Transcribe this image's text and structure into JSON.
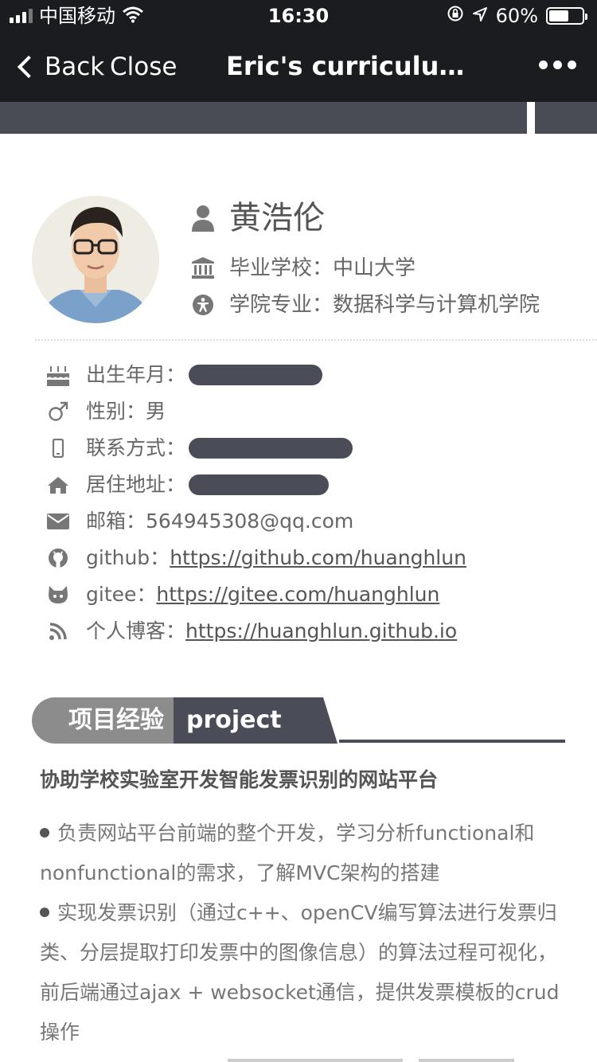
{
  "status_bar": {
    "carrier": "中国移动",
    "time": "16:30",
    "battery": "60%",
    "battery_level": 0.6
  },
  "nav": {
    "back_label": "Back",
    "close_label": "Close",
    "title": "Eric's curriculum..."
  },
  "profile": {
    "name": "黄浩伦",
    "school_label": "毕业学校：",
    "school": "中山大学",
    "major_label": "学院专业：",
    "major": "数据科学与计算机学院"
  },
  "details": {
    "birth_label": "出生年月：",
    "gender_label": "性别：",
    "gender": "男",
    "contact_label": "联系方式：",
    "address_label": "居住地址：",
    "email_label": "邮箱：",
    "email": "564945308@qq.com",
    "github_label": "github：",
    "github_url": "https://github.com/huanghlun",
    "gitee_label": "gitee：",
    "gitee_url": "https://gitee.com/huanghlun",
    "blog_label": "个人博客：",
    "blog_url": "https://huanghlun.github.io"
  },
  "section": {
    "title_cn": "项目经验",
    "title_en": "project"
  },
  "project": {
    "title": "协助学校实验室开发智能发票识别的网站平台",
    "bullets": [
      "负责网站平台前端的整个开发，学习分析functional和nonfunctional的需求，了解MVC架构的搭建",
      "实现发票识别（通过c++、openCV编写算法进行发票归类、分层提取打印发票中的图像信息）的算法过程可视化，前后端通过ajax + websocket通信，提供发票模板的crud操作"
    ]
  },
  "icons": {
    "status": [
      "signal-icon",
      "wifi-icon",
      "orientation-lock-icon",
      "location-icon",
      "battery-icon"
    ],
    "profile": [
      "user-icon",
      "university-icon",
      "universal-access-icon"
    ],
    "details": [
      "birthday-cake-icon",
      "male-icon",
      "mobile-icon",
      "home-icon",
      "envelope-icon",
      "github-icon",
      "gitee-icon",
      "rss-icon"
    ]
  },
  "colors": {
    "nav_bg": "#1b1c20",
    "accent_dark": "#4a4c58",
    "accent_grey": "#8c8c8c",
    "text": "#555555"
  }
}
